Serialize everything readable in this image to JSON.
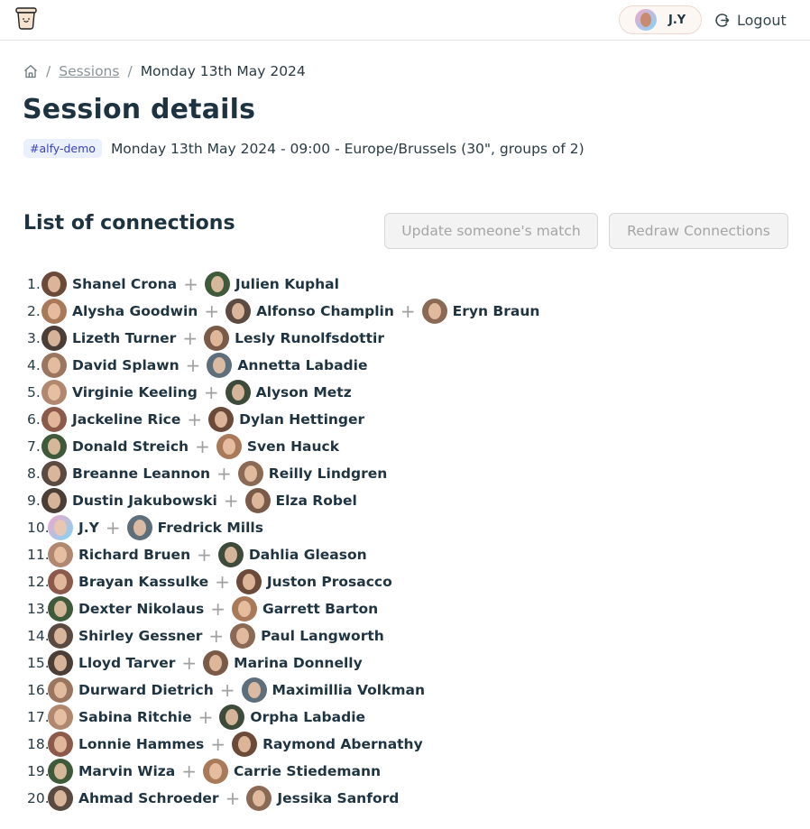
{
  "header": {
    "logo_icon": "cup-smiley-logo",
    "user": {
      "initials": "J.Y",
      "avatar_icon": "user-avatar"
    },
    "logout_label": "Logout",
    "logout_icon": "logout-icon"
  },
  "breadcrumb": {
    "home_icon": "home-icon",
    "items": [
      "Sessions",
      "Monday 13th May 2024"
    ],
    "separator": "/"
  },
  "page": {
    "title": "Session details",
    "tag": "#alfy-demo",
    "meta": "Monday 13th May 2024 - 09:00 - Europe/Brussels (30\", groups of 2)"
  },
  "connections": {
    "title": "List of connections",
    "update_button": "Update someone's match",
    "redraw_button": "Redraw Connections",
    "colors": {
      "disabled_text": "#a5a5a5",
      "tag_bg": "#ebf0fd",
      "tag_text": "#3a43b8",
      "heading": "#1d3340"
    },
    "groups": [
      {
        "num": "1.",
        "members": [
          "Shanel Crona",
          "Julien Kuphal"
        ]
      },
      {
        "num": "2.",
        "members": [
          "Alysha Goodwin",
          "Alfonso Champlin",
          "Eryn Braun"
        ]
      },
      {
        "num": "3.",
        "members": [
          "Lizeth Turner",
          "Lesly Runolfsdottir"
        ]
      },
      {
        "num": "4.",
        "members": [
          "David Splawn",
          "Annetta Labadie"
        ]
      },
      {
        "num": "5.",
        "members": [
          "Virginie Keeling",
          "Alyson Metz"
        ]
      },
      {
        "num": "6.",
        "members": [
          "Jackeline Rice",
          "Dylan Hettinger"
        ]
      },
      {
        "num": "7.",
        "members": [
          "Donald Streich",
          "Sven Hauck"
        ]
      },
      {
        "num": "8.",
        "members": [
          "Breanne Leannon",
          "Reilly Lindgren"
        ]
      },
      {
        "num": "9.",
        "members": [
          "Dustin Jakubowski",
          "Elza Robel"
        ]
      },
      {
        "num": "10.",
        "members": [
          "J.Y",
          "Fredrick Mills"
        ]
      },
      {
        "num": "11.",
        "members": [
          "Richard Bruen",
          "Dahlia Gleason"
        ]
      },
      {
        "num": "12.",
        "members": [
          "Brayan Kassulke",
          "Juston Prosacco"
        ]
      },
      {
        "num": "13.",
        "members": [
          "Dexter Nikolaus",
          "Garrett Barton"
        ]
      },
      {
        "num": "14.",
        "members": [
          "Shirley Gessner",
          "Paul Langworth"
        ]
      },
      {
        "num": "15.",
        "members": [
          "Lloyd Tarver",
          "Marina Donnelly"
        ]
      },
      {
        "num": "16.",
        "members": [
          "Durward Dietrich",
          "Maximillia Volkman"
        ]
      },
      {
        "num": "17.",
        "members": [
          "Sabina Ritchie",
          "Orpha Labadie"
        ]
      },
      {
        "num": "18.",
        "members": [
          "Lonnie Hammes",
          "Raymond Abernathy"
        ]
      },
      {
        "num": "19.",
        "members": [
          "Marvin Wiza",
          "Carrie Stiedemann"
        ]
      },
      {
        "num": "20.",
        "members": [
          "Ahmad Schroeder",
          "Jessika Sanford"
        ]
      }
    ]
  }
}
